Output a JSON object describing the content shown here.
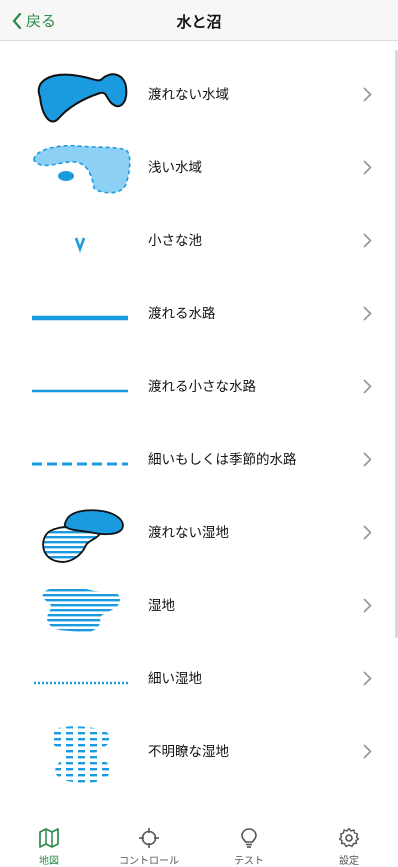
{
  "nav": {
    "back_label": "戻る",
    "title": "水と沼"
  },
  "items": [
    {
      "label": "渡れない水域",
      "icon": "uncrossable-water-icon"
    },
    {
      "label": "浅い水域",
      "icon": "shallow-water-icon"
    },
    {
      "label": "小さな池",
      "icon": "small-pond-icon"
    },
    {
      "label": "渡れる水路",
      "icon": "crossable-watercourse-icon"
    },
    {
      "label": "渡れる小さな水路",
      "icon": "small-crossable-watercourse-icon"
    },
    {
      "label": "細いもしくは季節的水路",
      "icon": "seasonal-watercourse-icon"
    },
    {
      "label": "渡れない湿地",
      "icon": "uncrossable-marsh-icon"
    },
    {
      "label": "湿地",
      "icon": "marsh-icon"
    },
    {
      "label": "細い湿地",
      "icon": "narrow-marsh-icon"
    },
    {
      "label": "不明瞭な湿地",
      "icon": "indistinct-marsh-icon"
    }
  ],
  "tabs": [
    {
      "label": "地図",
      "icon": "map-icon",
      "active": true
    },
    {
      "label": "コントロール",
      "icon": "control-icon",
      "active": false
    },
    {
      "label": "テスト",
      "icon": "lightbulb-icon",
      "active": false
    },
    {
      "label": "設定",
      "icon": "gear-icon",
      "active": false
    }
  ],
  "colors": {
    "accent": "#2a8a4a",
    "water": "#1a9be0",
    "water_light": "#8dd0f5"
  }
}
